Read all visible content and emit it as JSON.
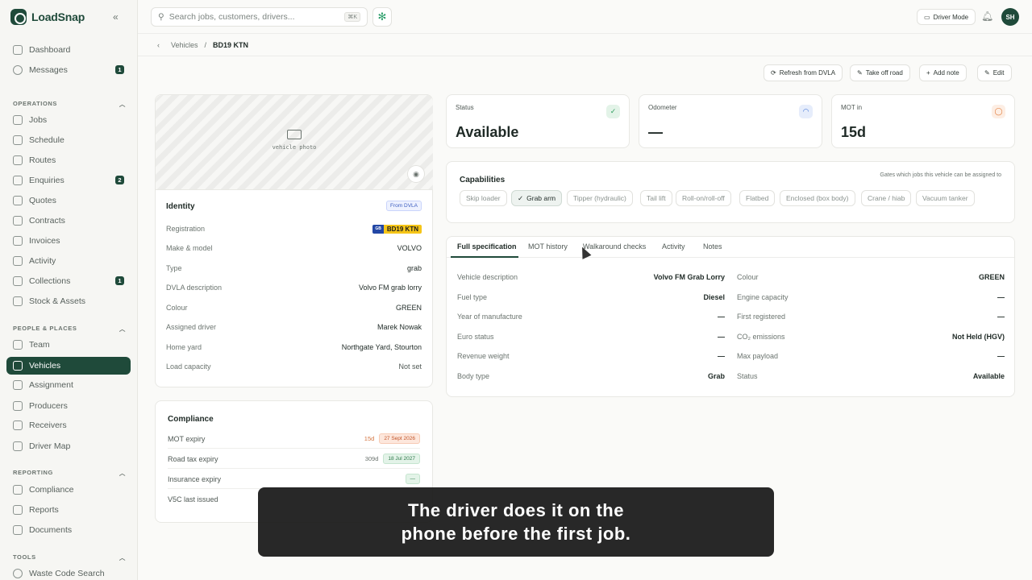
{
  "app": {
    "name": "LoadSnap"
  },
  "sidebar": {
    "items": [
      {
        "label": "Dashboard",
        "badge": null
      },
      {
        "label": "Messages",
        "badge": "1"
      }
    ],
    "sections": [
      {
        "title": "OPERATIONS",
        "items": [
          {
            "label": "Jobs"
          },
          {
            "label": "Schedule"
          },
          {
            "label": "Routes"
          },
          {
            "label": "Enquiries",
            "badge": "2"
          },
          {
            "label": "Quotes"
          },
          {
            "label": "Contracts"
          },
          {
            "label": "Invoices"
          },
          {
            "label": "Activity"
          },
          {
            "label": "Collections",
            "badge": "1"
          },
          {
            "label": "Stock & Assets"
          }
        ]
      },
      {
        "title": "PEOPLE & PLACES",
        "items": [
          {
            "label": "Team"
          },
          {
            "label": "Vehicles",
            "active": true
          },
          {
            "label": "Assignment"
          },
          {
            "label": "Producers"
          },
          {
            "label": "Receivers"
          },
          {
            "label": "Driver Map"
          }
        ]
      },
      {
        "title": "REPORTING",
        "items": [
          {
            "label": "Compliance"
          },
          {
            "label": "Reports"
          },
          {
            "label": "Documents"
          }
        ]
      },
      {
        "title": "TOOLS",
        "items": [
          {
            "label": "Waste Code Search"
          }
        ]
      }
    ]
  },
  "topbar": {
    "search_placeholder": "Search jobs, customers, drivers...",
    "search_kbd": "⌘K",
    "driver_mode": "Driver Mode",
    "avatar_initials": "SH"
  },
  "breadcrumb": {
    "parent": "Vehicles",
    "current": "BD19 KTN"
  },
  "actions": {
    "refresh": "Refresh from DVLA",
    "take_off": "Take off road",
    "add_note": "Add note",
    "edit": "Edit"
  },
  "photo": {
    "label": "vehicle photo"
  },
  "identity": {
    "title": "Identity",
    "source_pill": "From DVLA",
    "plate_country": "GB",
    "rows": [
      {
        "k": "Registration",
        "v": "BD19 KTN"
      },
      {
        "k": "Make & model",
        "v": "VOLVO"
      },
      {
        "k": "Type",
        "v": "grab"
      },
      {
        "k": "DVLA description",
        "v": "Volvo FM grab lorry"
      },
      {
        "k": "Colour",
        "v": "GREEN"
      },
      {
        "k": "Assigned driver",
        "v": "Marek Nowak"
      },
      {
        "k": "Home yard",
        "v": "Northgate Yard, Stourton"
      },
      {
        "k": "Load capacity",
        "v": "Not set"
      }
    ]
  },
  "compliance": {
    "title": "Compliance",
    "rows": [
      {
        "k": "MOT expiry",
        "days": "15d",
        "date": "27 Sept 2026",
        "level": "warn"
      },
      {
        "k": "Road tax expiry",
        "days": "309d",
        "date": "18 Jul 2027",
        "level": "ok"
      },
      {
        "k": "Insurance expiry",
        "days": "",
        "date": "—",
        "level": "ok"
      },
      {
        "k": "V5C last issued",
        "days": "",
        "date": "",
        "level": ""
      }
    ]
  },
  "stats": [
    {
      "label": "Status",
      "value": "Available",
      "color": "#2f9e5f"
    },
    {
      "label": "Odometer",
      "value": "—",
      "color": "#3b6fd6"
    },
    {
      "label": "MOT in",
      "value": "15d",
      "color": "#e07b3a"
    }
  ],
  "capabilities": {
    "title": "Capabilities",
    "note": "Gates which jobs this vehicle can be assigned to",
    "chips": [
      {
        "label": "Skip loader",
        "on": false
      },
      {
        "label": "Grab arm",
        "on": true
      },
      {
        "label": "Tipper (hydraulic)",
        "on": false
      },
      {
        "label": "Tail lift",
        "on": false
      },
      {
        "label": "Roll-on/roll-off",
        "on": false
      },
      {
        "label": "Flatbed",
        "on": false
      },
      {
        "label": "Enclosed (box body)",
        "on": false
      },
      {
        "label": "Crane / hiab",
        "on": false
      },
      {
        "label": "Vacuum tanker",
        "on": false
      }
    ]
  },
  "tabs": [
    "Full specification",
    "MOT history",
    "Walkaround checks",
    "Activity",
    "Notes"
  ],
  "spec": {
    "left": [
      {
        "k": "Vehicle description",
        "v": "Volvo FM Grab Lorry"
      },
      {
        "k": "Fuel type",
        "v": "Diesel"
      },
      {
        "k": "Year of manufacture",
        "v": "—"
      },
      {
        "k": "Euro status",
        "v": "—"
      },
      {
        "k": "Revenue weight",
        "v": "—"
      },
      {
        "k": "Body type",
        "v": "Grab"
      }
    ],
    "right": [
      {
        "k": "Colour",
        "v": "GREEN"
      },
      {
        "k": "Engine capacity",
        "v": "—"
      },
      {
        "k": "First registered",
        "v": "—"
      },
      {
        "k": "CO₂ emissions",
        "v": "Not Held (HGV)"
      },
      {
        "k": "Max payload",
        "v": "—"
      },
      {
        "k": "Status",
        "v": "Available"
      }
    ]
  },
  "caption": {
    "line1": "The driver does it on the",
    "line2": "phone before the first job."
  }
}
